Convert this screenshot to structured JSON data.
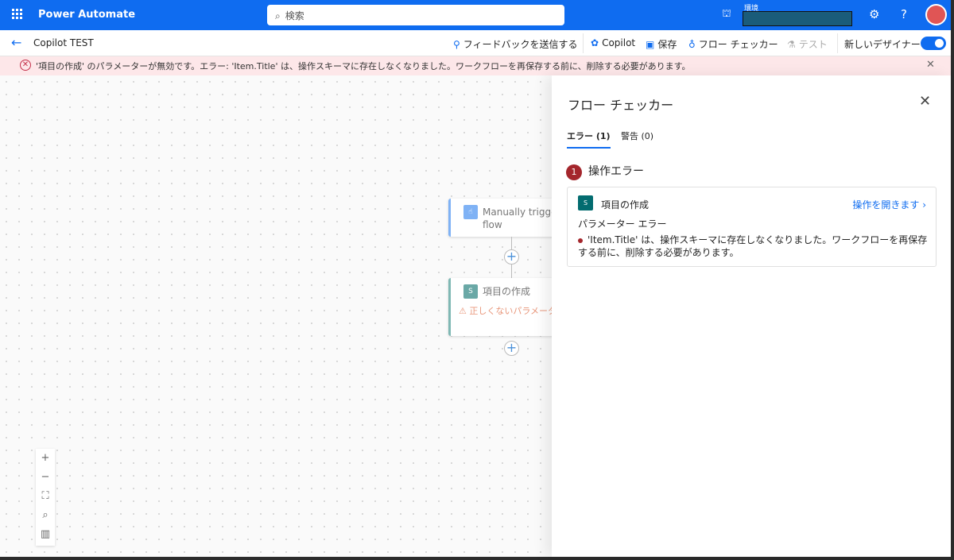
{
  "app": {
    "title": "Power Automate",
    "search_placeholder": "検索",
    "env_label": "環境"
  },
  "cmdbar": {
    "flow_name": "Copilot TEST",
    "feedback": "フィードバックを送信する",
    "copilot": "Copilot",
    "save": "保存",
    "flow_checker": "フロー チェッカー",
    "test": "テスト",
    "new_designer": "新しいデザイナー",
    "new_designer_on": true
  },
  "banner": {
    "message": "'項目の作成' のパラメーターが無効です。エラー: 'Item.Title' は、操作スキーマに存在しなくなりました。ワークフローを再保存する前に、削除する必要があります。"
  },
  "canvas": {
    "trigger": "Manually trigger flow",
    "action": "項目の作成",
    "action_warning": "正しくないパラメーター"
  },
  "panel": {
    "title": "フロー チェッカー",
    "tabs": [
      {
        "label": "エラー (1)",
        "active": true
      },
      {
        "label": "警告 (0)",
        "active": false
      }
    ],
    "section": {
      "count": "1",
      "title": "操作エラー"
    },
    "error": {
      "action": "項目の作成",
      "open": "操作を開きます",
      "type": "パラメーター エラー",
      "message": "'Item.Title' は、操作スキーマに存在しなくなりました。ワークフローを再保存する前に、削除する必要があります。"
    }
  },
  "colors": {
    "brand": "#0f6cf0",
    "error": "#a4262c",
    "banner_bg": "#fde7e9"
  }
}
